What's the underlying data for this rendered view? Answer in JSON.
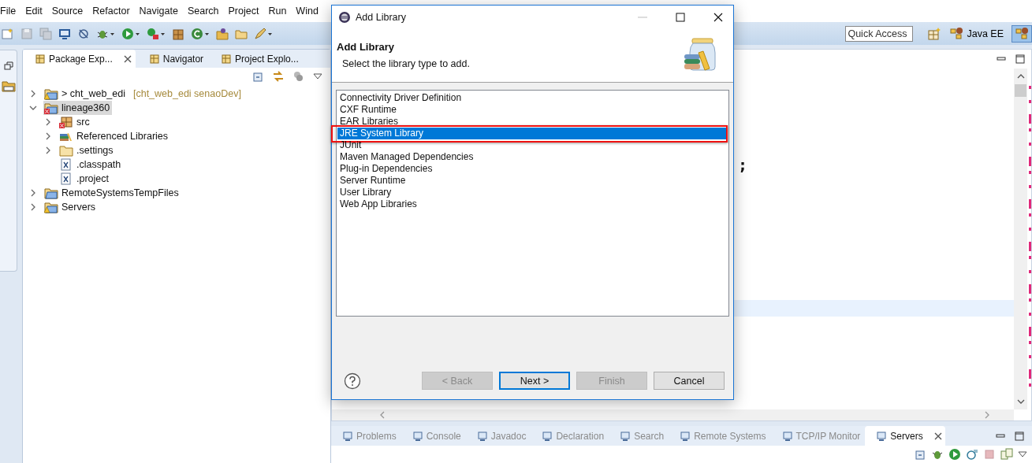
{
  "menu": [
    "File",
    "Edit",
    "Source",
    "Refactor",
    "Navigate",
    "Search",
    "Project",
    "Run",
    "Wind"
  ],
  "quick_access": {
    "placeholder": "Quick Access"
  },
  "perspectives": [
    {
      "label": "Java EE",
      "selected": false
    },
    {
      "selected": true
    }
  ],
  "left_panel": {
    "tabs": [
      {
        "label": "Package Exp...",
        "selected": true
      },
      {
        "label": "Navigator",
        "selected": false
      },
      {
        "label": "Project Explo...",
        "selected": false
      }
    ],
    "tree": [
      {
        "label": "> cht_web_edi",
        "decoration": "[cht_web_edi senaoDev]",
        "kind": "project-warning",
        "expanded": false,
        "selected": false
      },
      {
        "label": "lineage360",
        "kind": "project-error",
        "expanded": true,
        "selected": true,
        "children": [
          {
            "label": "src",
            "kind": "package-error",
            "expanded": false,
            "selected": false
          },
          {
            "label": "Referenced Libraries",
            "kind": "library",
            "expanded": false,
            "selected": false
          },
          {
            "label": ".settings",
            "kind": "folder",
            "expanded": false,
            "selected": false
          },
          {
            "label": ".classpath",
            "kind": "file",
            "selected": false
          },
          {
            "label": ".project",
            "kind": "file",
            "selected": false
          }
        ]
      },
      {
        "label": "RemoteSystemsTempFiles",
        "kind": "project",
        "expanded": false,
        "selected": false
      },
      {
        "label": "Servers",
        "kind": "project-warning",
        "expanded": false,
        "selected": false
      }
    ]
  },
  "editor": {
    "code_fragment": ";"
  },
  "bottom_panel": {
    "tabs": [
      {
        "label": "Problems",
        "selected": false
      },
      {
        "label": "Console",
        "selected": false
      },
      {
        "label": "Javadoc",
        "selected": false
      },
      {
        "label": "Declaration",
        "selected": false
      },
      {
        "label": "Search",
        "selected": false
      },
      {
        "label": "Remote Systems",
        "selected": false
      },
      {
        "label": "TCP/IP Monitor",
        "selected": false
      },
      {
        "label": "Servers",
        "selected": true
      }
    ]
  },
  "dialog": {
    "title": "Add Library",
    "heading": "Add Library",
    "description": "Select the library type to add.",
    "library_types": [
      {
        "label": "Connectivity Driver Definition",
        "selected": false
      },
      {
        "label": "CXF Runtime",
        "selected": false
      },
      {
        "label": "EAR Libraries",
        "selected": false
      },
      {
        "label": "JRE System Library",
        "selected": true
      },
      {
        "label": "JUnit",
        "selected": false
      },
      {
        "label": "Maven Managed Dependencies",
        "selected": false
      },
      {
        "label": "Plug-in Dependencies",
        "selected": false
      },
      {
        "label": "Server Runtime",
        "selected": false
      },
      {
        "label": "User Library",
        "selected": false
      },
      {
        "label": "Web App Libraries",
        "selected": false
      }
    ],
    "buttons": [
      {
        "label": "< Back",
        "disabled": true,
        "default": false
      },
      {
        "label": "Next >",
        "disabled": false,
        "default": true
      },
      {
        "label": "Finish",
        "disabled": true,
        "default": false
      },
      {
        "label": "Cancel",
        "disabled": false,
        "default": false
      }
    ]
  }
}
